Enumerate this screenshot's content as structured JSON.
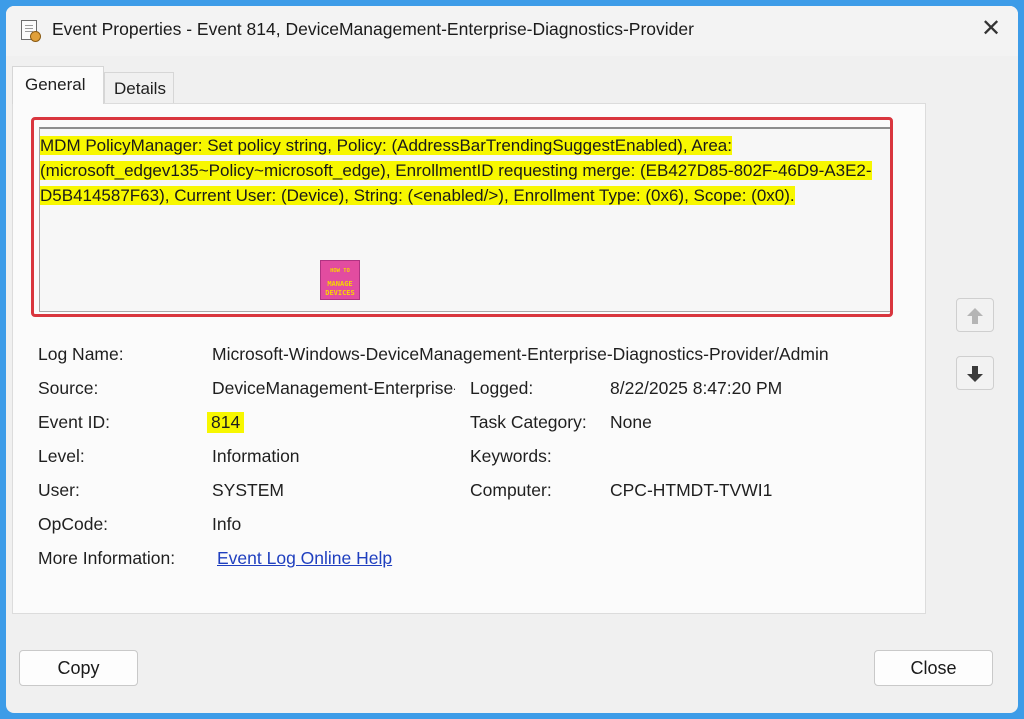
{
  "window": {
    "title": "Event Properties - Event 814, DeviceManagement-Enterprise-Diagnostics-Provider",
    "close_glyph": "✕"
  },
  "tabs": [
    {
      "label": "General",
      "active": true
    },
    {
      "label": "Details",
      "active": false
    }
  ],
  "description": "MDM PolicyManager: Set policy string, Policy: (AddressBarTrendingSuggestEnabled), Area: (microsoft_edgev135~Policy~microsoft_edge), EnrollmentID requesting merge: (EB427D85-802F-46D9-A3E2-D5B414587F63), Current User: (Device), String: (<enabled/>), Enrollment Type: (0x6), Scope: (0x0).",
  "watermark": {
    "line1": "HOW TO",
    "line2": "MANAGE",
    "line3": "DEVICES"
  },
  "fields": {
    "log_name": {
      "label": "Log Name:",
      "value": "Microsoft-Windows-DeviceManagement-Enterprise-Diagnostics-Provider/Admin"
    },
    "source": {
      "label": "Source:",
      "value": "DeviceManagement-Enterprise-Diagnostics-Provider"
    },
    "logged": {
      "label": "Logged:",
      "value": "8/22/2025 8:47:20 PM"
    },
    "event_id": {
      "label": "Event ID:",
      "value": "814"
    },
    "task_category": {
      "label": "Task Category:",
      "value": "None"
    },
    "level": {
      "label": "Level:",
      "value": "Information"
    },
    "keywords": {
      "label": "Keywords:",
      "value": ""
    },
    "user": {
      "label": "User:",
      "value": "SYSTEM"
    },
    "computer": {
      "label": "Computer:",
      "value": "CPC-HTMDT-TVWI1"
    },
    "opcode": {
      "label": "OpCode:",
      "value": "Info"
    },
    "more_info": {
      "label": "More Information:",
      "link": "Event Log Online Help"
    }
  },
  "buttons": {
    "copy": "Copy",
    "close": "Close"
  },
  "icons": {
    "scroll_up": "arrow-up-icon",
    "scroll_down": "arrow-down-icon",
    "app": "event-log-icon"
  },
  "colors": {
    "highlight": "#f7f700",
    "annotation_border": "#d9363e",
    "link": "#1f3fbf",
    "backdrop": "#3d9ce8"
  }
}
